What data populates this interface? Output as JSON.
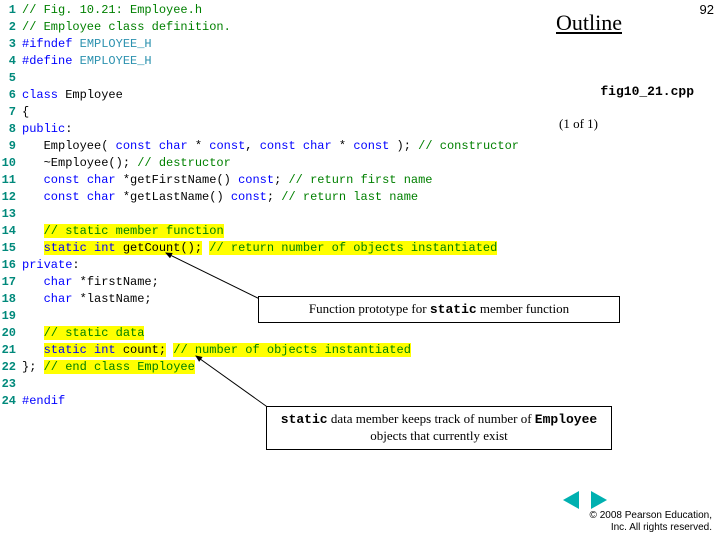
{
  "page_number": "92",
  "outline_title": "Outline",
  "caption_file": "fig10_21.cpp",
  "caption_part": "(1 of 1)",
  "code": {
    "lines": [
      {
        "n": "1",
        "segs": [
          {
            "t": "// Fig. 10.21: Employee.h",
            "cls": "c-green"
          }
        ]
      },
      {
        "n": "2",
        "segs": [
          {
            "t": "// Employee class definition.",
            "cls": "c-green"
          }
        ]
      },
      {
        "n": "3",
        "segs": [
          {
            "t": "#ifndef",
            "cls": "c-blue"
          },
          {
            "t": " ",
            "cls": "c-black"
          },
          {
            "t": "EMPLOYEE_H",
            "cls": "c-teal"
          }
        ]
      },
      {
        "n": "4",
        "segs": [
          {
            "t": "#define",
            "cls": "c-blue"
          },
          {
            "t": " ",
            "cls": "c-black"
          },
          {
            "t": "EMPLOYEE_H",
            "cls": "c-teal"
          }
        ]
      },
      {
        "n": "5",
        "segs": [
          {
            "t": " ",
            "cls": "c-black"
          }
        ]
      },
      {
        "n": "6",
        "segs": [
          {
            "t": "class",
            "cls": "c-blue"
          },
          {
            "t": " Employee",
            "cls": "c-black"
          }
        ]
      },
      {
        "n": "7",
        "segs": [
          {
            "t": "{",
            "cls": "c-black"
          }
        ]
      },
      {
        "n": "8",
        "segs": [
          {
            "t": "public",
            "cls": "c-blue"
          },
          {
            "t": ":",
            "cls": "c-black"
          }
        ]
      },
      {
        "n": "9",
        "segs": [
          {
            "t": "   Employee( ",
            "cls": "c-black"
          },
          {
            "t": "const",
            "cls": "c-blue"
          },
          {
            "t": " ",
            "cls": "c-black"
          },
          {
            "t": "char",
            "cls": "c-blue"
          },
          {
            "t": " * ",
            "cls": "c-black"
          },
          {
            "t": "const",
            "cls": "c-blue"
          },
          {
            "t": ", ",
            "cls": "c-black"
          },
          {
            "t": "const",
            "cls": "c-blue"
          },
          {
            "t": " ",
            "cls": "c-black"
          },
          {
            "t": "char",
            "cls": "c-blue"
          },
          {
            "t": " * ",
            "cls": "c-black"
          },
          {
            "t": "const",
            "cls": "c-blue"
          },
          {
            "t": " ); ",
            "cls": "c-black"
          },
          {
            "t": "// constructor",
            "cls": "c-green"
          }
        ]
      },
      {
        "n": "10",
        "segs": [
          {
            "t": "   ~Employee(); ",
            "cls": "c-black"
          },
          {
            "t": "// destructor",
            "cls": "c-green"
          }
        ]
      },
      {
        "n": "11",
        "segs": [
          {
            "t": "   ",
            "cls": "c-black"
          },
          {
            "t": "const",
            "cls": "c-blue"
          },
          {
            "t": " ",
            "cls": "c-black"
          },
          {
            "t": "char",
            "cls": "c-blue"
          },
          {
            "t": " *getFirstName() ",
            "cls": "c-black"
          },
          {
            "t": "const",
            "cls": "c-blue"
          },
          {
            "t": "; ",
            "cls": "c-black"
          },
          {
            "t": "// return first name",
            "cls": "c-green"
          }
        ]
      },
      {
        "n": "12",
        "segs": [
          {
            "t": "   ",
            "cls": "c-black"
          },
          {
            "t": "const",
            "cls": "c-blue"
          },
          {
            "t": " ",
            "cls": "c-black"
          },
          {
            "t": "char",
            "cls": "c-blue"
          },
          {
            "t": " *getLastName() ",
            "cls": "c-black"
          },
          {
            "t": "const",
            "cls": "c-blue"
          },
          {
            "t": "; ",
            "cls": "c-black"
          },
          {
            "t": "// return last name",
            "cls": "c-green"
          }
        ]
      },
      {
        "n": "13",
        "segs": [
          {
            "t": " ",
            "cls": "c-black"
          }
        ]
      },
      {
        "n": "14",
        "segs": [
          {
            "t": "   ",
            "cls": "c-black"
          },
          {
            "t": "// static member function",
            "cls": "c-green",
            "hl": true
          }
        ]
      },
      {
        "n": "15",
        "segs": [
          {
            "t": "   ",
            "cls": "c-black"
          },
          {
            "t": "static",
            "cls": "c-blue",
            "hl": true
          },
          {
            "t": " ",
            "cls": "c-black",
            "hl": true
          },
          {
            "t": "int",
            "cls": "c-blue",
            "hl": true
          },
          {
            "t": " getCount();",
            "cls": "c-black",
            "hl": true
          },
          {
            "t": " ",
            "cls": "c-black"
          },
          {
            "t": "// return number of objects instantiated",
            "cls": "c-green",
            "hl": true
          }
        ]
      },
      {
        "n": "16",
        "segs": [
          {
            "t": "private",
            "cls": "c-blue"
          },
          {
            "t": ":",
            "cls": "c-black"
          }
        ]
      },
      {
        "n": "17",
        "segs": [
          {
            "t": "   ",
            "cls": "c-black"
          },
          {
            "t": "char",
            "cls": "c-blue"
          },
          {
            "t": " *firstName;",
            "cls": "c-black"
          }
        ]
      },
      {
        "n": "18",
        "segs": [
          {
            "t": "   ",
            "cls": "c-black"
          },
          {
            "t": "char",
            "cls": "c-blue"
          },
          {
            "t": " *lastName;",
            "cls": "c-black"
          }
        ]
      },
      {
        "n": "19",
        "segs": [
          {
            "t": " ",
            "cls": "c-black"
          }
        ]
      },
      {
        "n": "20",
        "segs": [
          {
            "t": "   ",
            "cls": "c-black"
          },
          {
            "t": "// static data",
            "cls": "c-green",
            "hl": true
          }
        ]
      },
      {
        "n": "21",
        "segs": [
          {
            "t": "   ",
            "cls": "c-black"
          },
          {
            "t": "static",
            "cls": "c-blue",
            "hl": true
          },
          {
            "t": " ",
            "cls": "c-black",
            "hl": true
          },
          {
            "t": "int",
            "cls": "c-blue",
            "hl": true
          },
          {
            "t": " count;",
            "cls": "c-black",
            "hl": true
          },
          {
            "t": " ",
            "cls": "c-black"
          },
          {
            "t": "// number of objects instantiated",
            "cls": "c-green",
            "hl": true
          }
        ]
      },
      {
        "n": "22",
        "segs": [
          {
            "t": "}; ",
            "cls": "c-black"
          },
          {
            "t": "// end class Employee",
            "cls": "c-green",
            "hl": true
          }
        ]
      },
      {
        "n": "23",
        "segs": [
          {
            "t": " ",
            "cls": "c-black"
          }
        ]
      },
      {
        "n": "24",
        "segs": [
          {
            "t": "#endif",
            "cls": "c-blue"
          }
        ]
      }
    ]
  },
  "callouts": {
    "c1_pre": "Function prototype for ",
    "c1_code": "static",
    "c1_post": " member function",
    "c2_code1": "static",
    "c2_mid": " data member keeps track of number of ",
    "c2_code2": "Employee",
    "c2_post": " objects that currently exist"
  },
  "footer": {
    "line1": "© 2008 Pearson Education,",
    "line2": "Inc. All rights reserved."
  }
}
